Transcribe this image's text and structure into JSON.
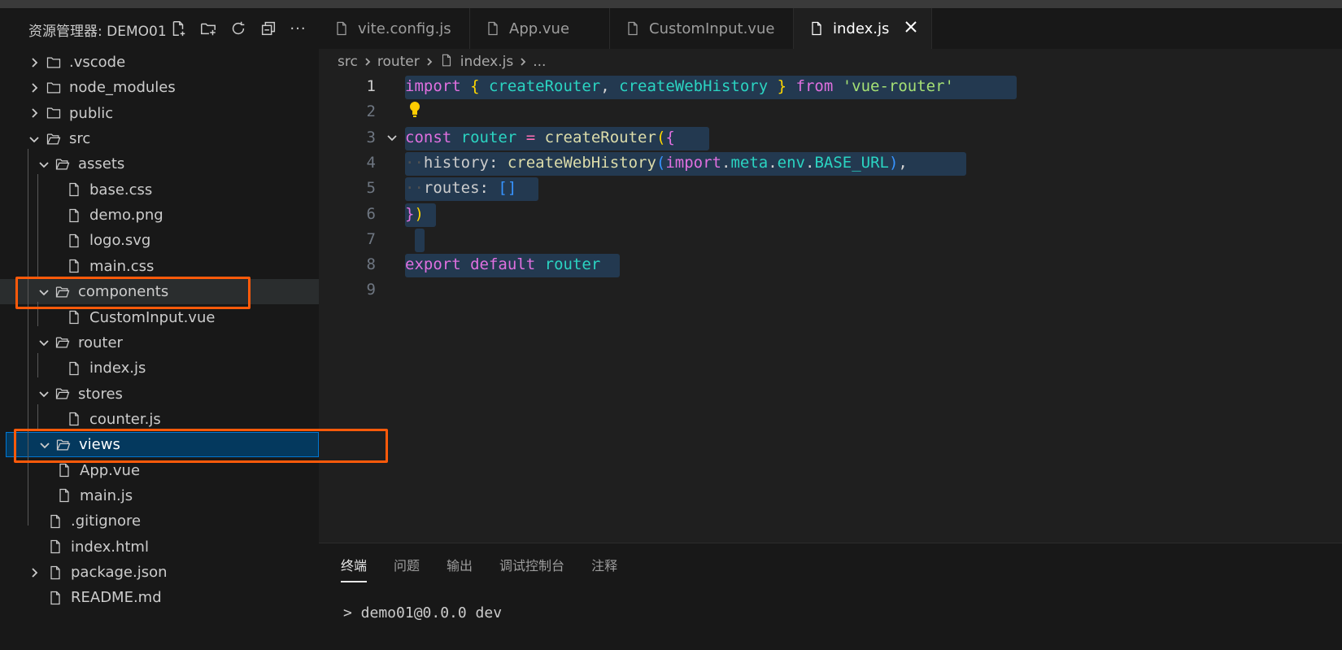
{
  "explorer": {
    "title": "资源管理器: DEMO01",
    "actions": [
      "new-file-icon",
      "new-folder-icon",
      "refresh-icon",
      "collapse-all-icon",
      "more-icon"
    ],
    "more_label": "···",
    "items": [
      {
        "label": ".vscode",
        "type": "folder",
        "expanded": false
      },
      {
        "label": "node_modules",
        "type": "folder",
        "expanded": false
      },
      {
        "label": "public",
        "type": "folder",
        "expanded": false
      },
      {
        "label": "src",
        "type": "folder",
        "expanded": true
      },
      {
        "label": "assets",
        "type": "folder",
        "expanded": true
      },
      {
        "label": "base.css",
        "type": "file"
      },
      {
        "label": "demo.png",
        "type": "file"
      },
      {
        "label": "logo.svg",
        "type": "file"
      },
      {
        "label": "main.css",
        "type": "file"
      },
      {
        "label": "components",
        "type": "folder",
        "expanded": true,
        "highlighted": true
      },
      {
        "label": "CustomInput.vue",
        "type": "file"
      },
      {
        "label": "router",
        "type": "folder",
        "expanded": true
      },
      {
        "label": "index.js",
        "type": "file"
      },
      {
        "label": "stores",
        "type": "folder",
        "expanded": true
      },
      {
        "label": "counter.js",
        "type": "file"
      },
      {
        "label": "views",
        "type": "folder",
        "expanded": true,
        "selected": true,
        "highlighted": true
      },
      {
        "label": "App.vue",
        "type": "file"
      },
      {
        "label": "main.js",
        "type": "file"
      },
      {
        "label": ".gitignore",
        "type": "file"
      },
      {
        "label": "index.html",
        "type": "file"
      },
      {
        "label": "package.json",
        "type": "file",
        "collapsed_chevron": true
      },
      {
        "label": "README.md",
        "type": "file"
      }
    ]
  },
  "tabs": [
    {
      "label": "vite.config.js",
      "active": false
    },
    {
      "label": "App.vue",
      "active": false
    },
    {
      "label": "CustomInput.vue",
      "active": false
    },
    {
      "label": "index.js",
      "active": true
    }
  ],
  "breadcrumb": {
    "parts": [
      "src",
      "router",
      "index.js",
      "..."
    ]
  },
  "editor": {
    "line_numbers": [
      "1",
      "2",
      "3",
      "4",
      "5",
      "6",
      "7",
      "8",
      "9"
    ],
    "lines": [
      [
        {
          "t": "import",
          "c": "k-purple"
        },
        {
          "t": " { ",
          "c": "k-yellow"
        },
        {
          "t": "createRouter",
          "c": "k-teal"
        },
        {
          "t": ", ",
          "c": "k-white"
        },
        {
          "t": "createWebHistory",
          "c": "k-teal"
        },
        {
          "t": " } ",
          "c": "k-yellow"
        },
        {
          "t": "from",
          "c": "k-purple"
        },
        {
          "t": " ",
          "c": "k-white"
        },
        {
          "t": "'vue-router'",
          "c": "k-str"
        }
      ],
      [],
      [
        {
          "t": "const",
          "c": "k-purple"
        },
        {
          "t": " ",
          "c": "k-white"
        },
        {
          "t": "router",
          "c": "k-teal"
        },
        {
          "t": " ",
          "c": "k-white"
        },
        {
          "t": "=",
          "c": "k-op"
        },
        {
          "t": " ",
          "c": "k-white"
        },
        {
          "t": "createRouter",
          "c": "k-func"
        },
        {
          "t": "(",
          "c": "k-yellow"
        },
        {
          "t": "{",
          "c": "k-purple"
        }
      ],
      [
        {
          "t": "··",
          "c": "dot"
        },
        {
          "t": "history",
          "c": "k-prop"
        },
        {
          "t": ": ",
          "c": "k-white"
        },
        {
          "t": "createWebHistory",
          "c": "k-func"
        },
        {
          "t": "(",
          "c": "k-blue"
        },
        {
          "t": "import",
          "c": "k-purple"
        },
        {
          "t": ".",
          "c": "k-white"
        },
        {
          "t": "meta",
          "c": "k-teal"
        },
        {
          "t": ".",
          "c": "k-white"
        },
        {
          "t": "env",
          "c": "k-teal"
        },
        {
          "t": ".",
          "c": "k-white"
        },
        {
          "t": "BASE_URL",
          "c": "k-teal"
        },
        {
          "t": ")",
          "c": "k-blue"
        },
        {
          "t": ",",
          "c": "k-white"
        }
      ],
      [
        {
          "t": "··",
          "c": "dot"
        },
        {
          "t": "routes",
          "c": "k-prop"
        },
        {
          "t": ": ",
          "c": "k-white"
        },
        {
          "t": "[]",
          "c": "k-blue"
        }
      ],
      [
        {
          "t": "}",
          "c": "k-purple"
        },
        {
          "t": ")",
          "c": "k-yellow"
        }
      ],
      [],
      [
        {
          "t": "export",
          "c": "k-purple"
        },
        {
          "t": " ",
          "c": "k-white"
        },
        {
          "t": "default",
          "c": "k-purple"
        },
        {
          "t": " ",
          "c": "k-white"
        },
        {
          "t": "router",
          "c": "k-teal"
        }
      ],
      []
    ]
  },
  "panel": {
    "tabs": [
      "终端",
      "问题",
      "输出",
      "调试控制台",
      "注释"
    ],
    "terminal_line": "> demo01@0.0.0 dev"
  },
  "colors": {
    "highlight_box": "#ff5a0a",
    "selection": "#04395e",
    "accent": "#0078d4"
  }
}
